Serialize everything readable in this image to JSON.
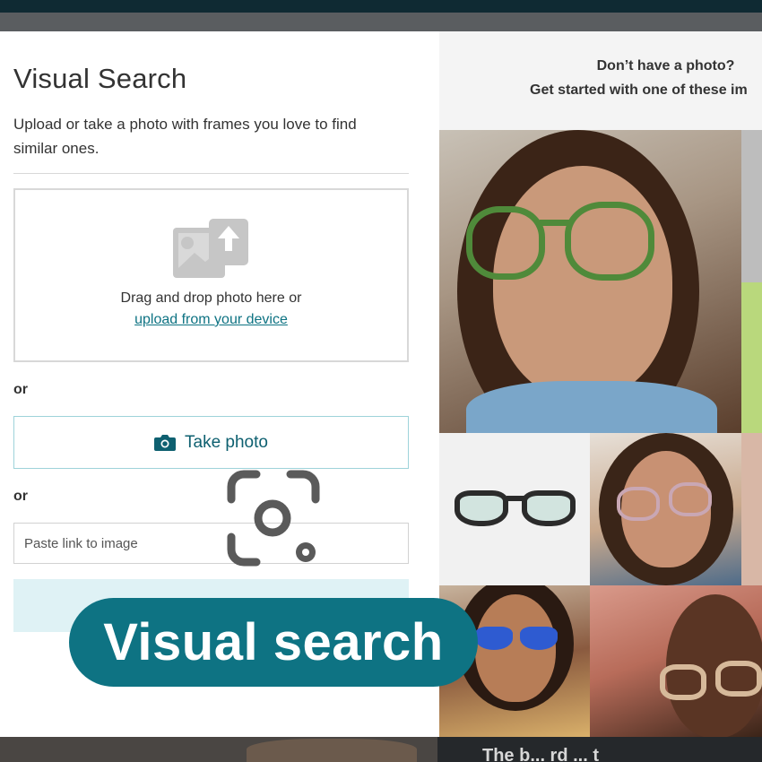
{
  "modal": {
    "title": "Visual Search",
    "description": "Upload or take a photo with frames you love to find similar ones.",
    "dropzone": {
      "text": "Drag and drop photo here or",
      "link": "upload from your device"
    },
    "or_label_1": "or",
    "take_photo_label": "Take photo",
    "or_label_2": "or",
    "paste_placeholder": "Paste link to image"
  },
  "examples": {
    "heading_line1": "Don’t have a photo?",
    "heading_line2": "Get started with one of these im"
  },
  "overlay_banner": "Visual search",
  "bottom_peek_text": "The b... rd ...  t",
  "colors": {
    "accent": "#0e7383",
    "button_tint": "#dff2f5",
    "topbar": "#0f2a33"
  },
  "icons": [
    "image-upload-icon",
    "camera-icon",
    "visual-search-lens-icon"
  ]
}
